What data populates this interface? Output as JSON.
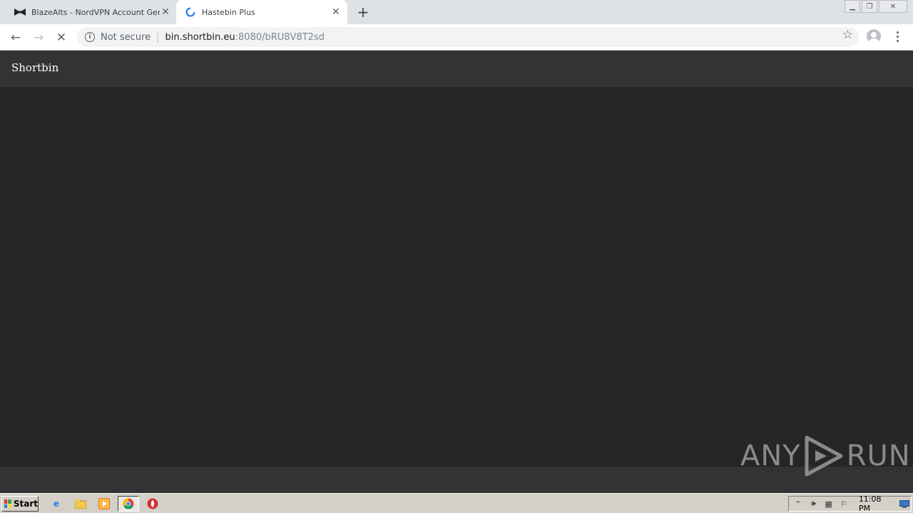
{
  "browser": {
    "tabs": [
      {
        "title": "BlazeAlts - NordVPN Account Genera",
        "icon": "bowtie-icon"
      },
      {
        "title": "Hastebin Plus",
        "icon": "loading-spinner-icon"
      }
    ],
    "address": {
      "security_label": "Not secure",
      "host": "bin.shortbin.eu",
      "path": ":8080/bRU8V8T2sd"
    }
  },
  "page": {
    "brand": "Shortbin"
  },
  "watermark": {
    "left": "ANY",
    "right": "RUN"
  },
  "taskbar": {
    "start_label": "Start",
    "clock": "11:08 PM"
  }
}
